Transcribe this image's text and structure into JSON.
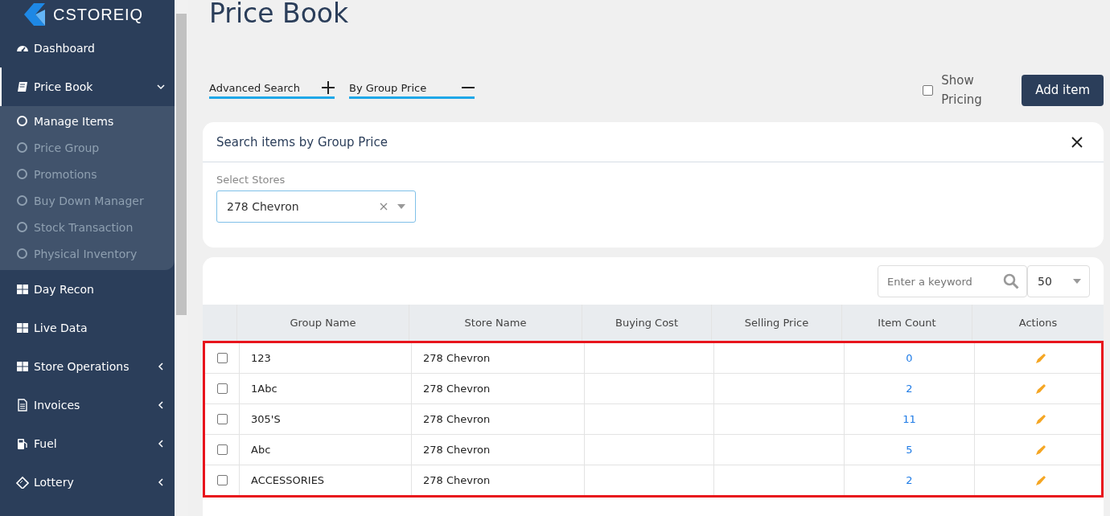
{
  "sidebar": {
    "logo": "CSTOREIQ",
    "items": [
      {
        "label": "Dashboard",
        "selected": false
      },
      {
        "label": "Price Book",
        "selected": true,
        "expanded": true,
        "children": [
          {
            "label": "Manage Items",
            "selected": true
          },
          {
            "label": "Price Group",
            "selected": false
          },
          {
            "label": "Promotions",
            "selected": false
          },
          {
            "label": "Buy Down Manager",
            "selected": false
          },
          {
            "label": "Stock Transaction",
            "selected": false
          },
          {
            "label": "Physical Inventory",
            "selected": false
          }
        ]
      },
      {
        "label": "Day Recon",
        "selected": false
      },
      {
        "label": "Live Data",
        "selected": false
      },
      {
        "label": "Store Operations",
        "selected": false,
        "expanded": false
      },
      {
        "label": "Invoices",
        "selected": false,
        "expanded": false
      },
      {
        "label": "Fuel",
        "selected": false,
        "expanded": false
      },
      {
        "label": "Lottery",
        "selected": false,
        "expanded": false
      }
    ]
  },
  "page_title": "Price Book",
  "toggles": [
    {
      "label": "Advanced Search",
      "expanded": false
    },
    {
      "label": "By Group Price",
      "expanded": true
    }
  ],
  "show_pricing": {
    "label": "Show Pricing",
    "checked": false
  },
  "add_button": "Add item",
  "search_panel": {
    "title": "Search items by Group Price",
    "field_label": "Select Stores",
    "store": "278 Chevron"
  },
  "table": {
    "search_placeholder": "Enter a keyword",
    "page_size": "50",
    "columns": [
      "Group Name",
      "Store Name",
      "Buying Cost",
      "Selling Price",
      "Item Count",
      "Actions"
    ],
    "highlighted": true,
    "rows": [
      {
        "checked": false,
        "group": "123",
        "store": "278 Chevron",
        "count": "0"
      },
      {
        "checked": false,
        "group": "1Abc",
        "store": "278 Chevron",
        "count": "2"
      },
      {
        "checked": false,
        "group": "305'S",
        "store": "278 Chevron",
        "count": "11"
      },
      {
        "checked": false,
        "group": "Abc",
        "store": "278 Chevron",
        "count": "5"
      },
      {
        "checked": false,
        "group": "ACCESSORIES",
        "store": "278 Chevron",
        "count": "2"
      }
    ]
  }
}
